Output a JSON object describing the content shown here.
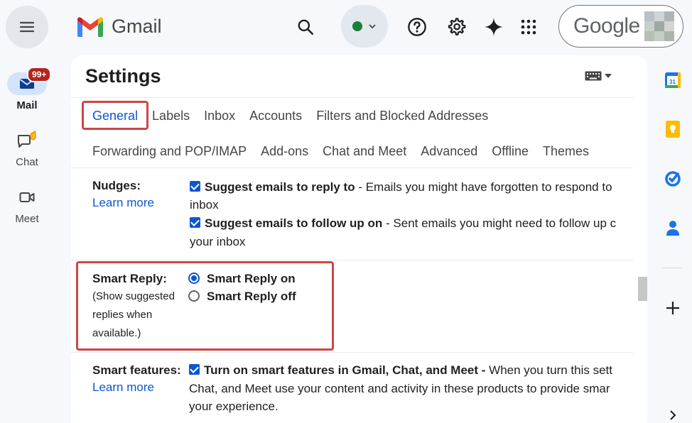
{
  "header": {
    "app_name": "Gmail",
    "google_label": "Google"
  },
  "rail": {
    "mail_label": "Mail",
    "mail_badge": "99+",
    "chat_label": "Chat",
    "meet_label": "Meet"
  },
  "settings": {
    "title": "Settings",
    "tabs_row1": [
      "General",
      "Labels",
      "Inbox",
      "Accounts",
      "Filters and Blocked Addresses"
    ],
    "tabs_row2": [
      "Forwarding and POP/IMAP",
      "Add-ons",
      "Chat and Meet",
      "Advanced",
      "Offline",
      "Themes"
    ],
    "nudges": {
      "label": "Nudges:",
      "learn_more": "Learn more",
      "opt1_bold": "Suggest emails to reply to",
      "opt1_rest": " - Emails you might have forgotten to respond to",
      "opt1_wrap": "inbox",
      "opt2_bold": "Suggest emails to follow up on",
      "opt2_rest": " - Sent emails you might need to follow up c",
      "opt2_wrap": "your inbox"
    },
    "smart_reply": {
      "label": "Smart Reply:",
      "desc_line1": "(Show suggested",
      "desc_line2": "replies when",
      "desc_line3": "available.)",
      "on_label": "Smart Reply on",
      "off_label": "Smart Reply off",
      "selected": "on"
    },
    "smart_features": {
      "label": "Smart features:",
      "learn_more": "Learn more",
      "opt_bold": "Turn on smart features in Gmail, Chat, and Meet -",
      "opt_rest": " When you turn this sett",
      "line2": "Chat, and Meet use your content and activity in these products to provide smar",
      "line3": "your experience."
    }
  },
  "side_panel": {
    "calendar_day": "31"
  },
  "colors": {
    "accent": "#0b57d0",
    "highlight_box": "#d04545",
    "badge": "#b3261e"
  }
}
